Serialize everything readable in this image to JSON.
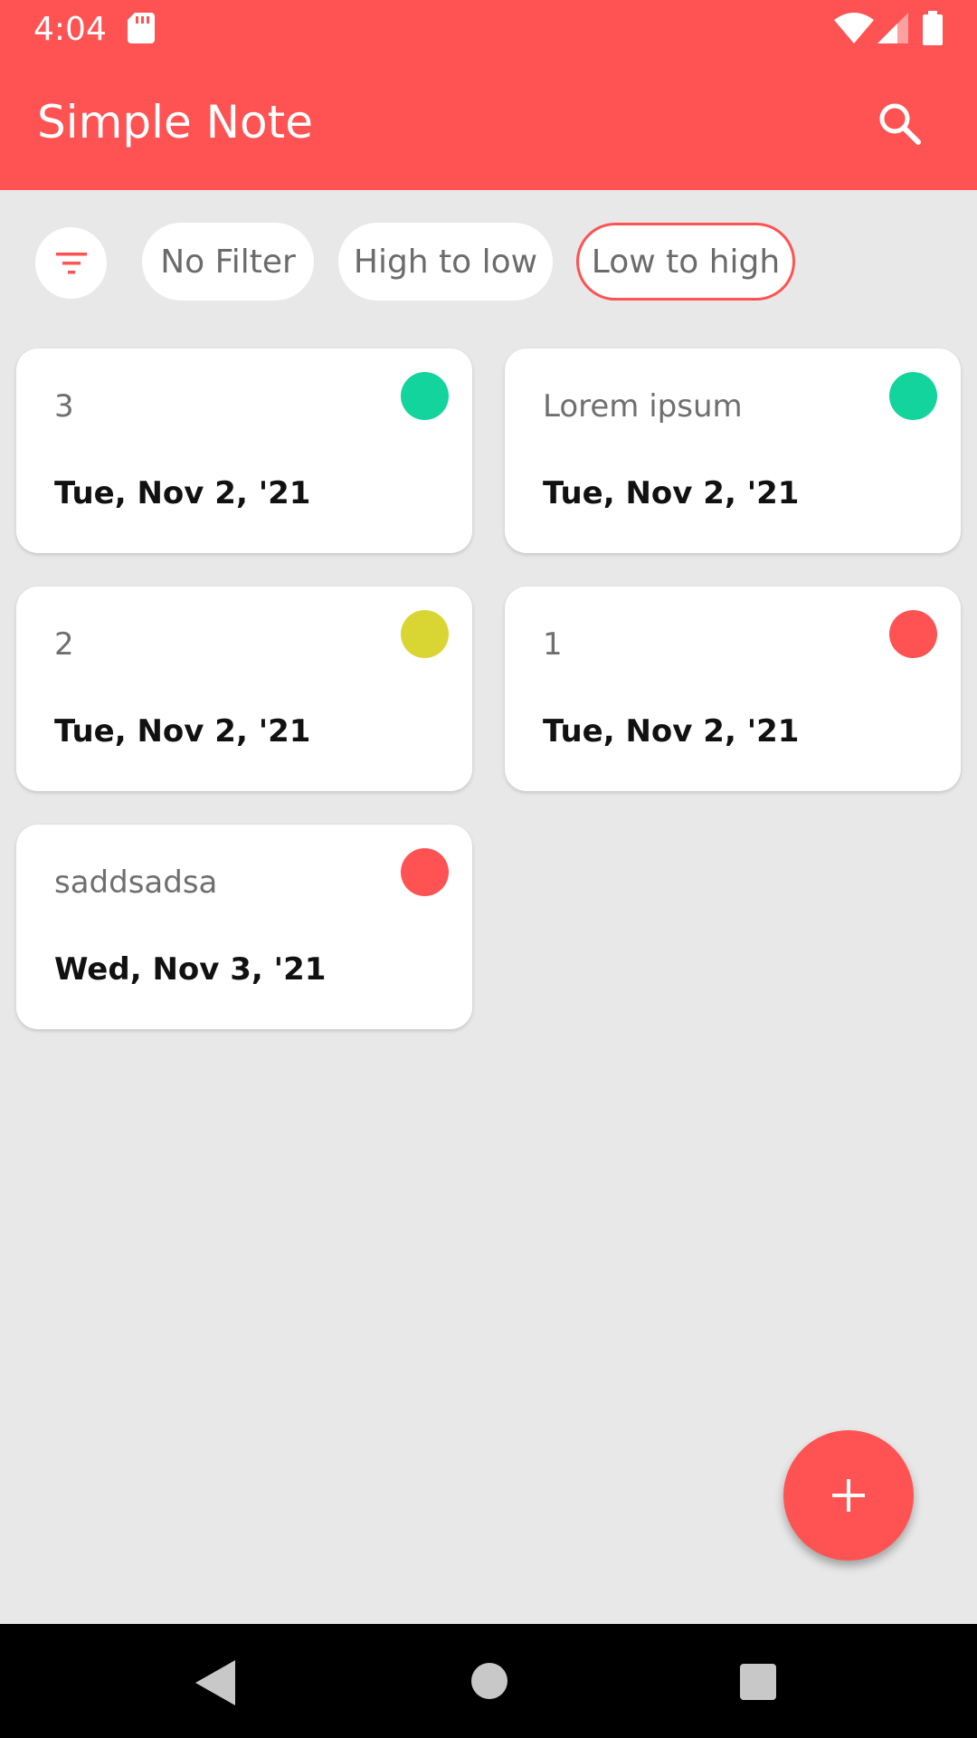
{
  "status_bar": {
    "time": "4:04"
  },
  "app_bar": {
    "title": "Simple Note",
    "color": "#ff5252"
  },
  "filters": {
    "chips": [
      {
        "label": "No Filter",
        "selected": false
      },
      {
        "label": "High to low",
        "selected": false
      },
      {
        "label": "Low to high",
        "selected": true
      }
    ]
  },
  "notes": [
    {
      "title": "3",
      "date": "Tue, Nov 2, '21",
      "color": "#13d49d"
    },
    {
      "title": "Lorem ipsum",
      "date": "Tue, Nov 2, '21",
      "color": "#13d49d"
    },
    {
      "title": "2",
      "date": "Tue, Nov 2, '21",
      "color": "#d9d634"
    },
    {
      "title": "1",
      "date": "Tue, Nov 2, '21",
      "color": "#ff5252"
    },
    {
      "title": "saddsadsa",
      "date": "Wed, Nov 3, '21",
      "color": "#ff5252"
    }
  ],
  "fab": {
    "icon": "plus-icon"
  }
}
